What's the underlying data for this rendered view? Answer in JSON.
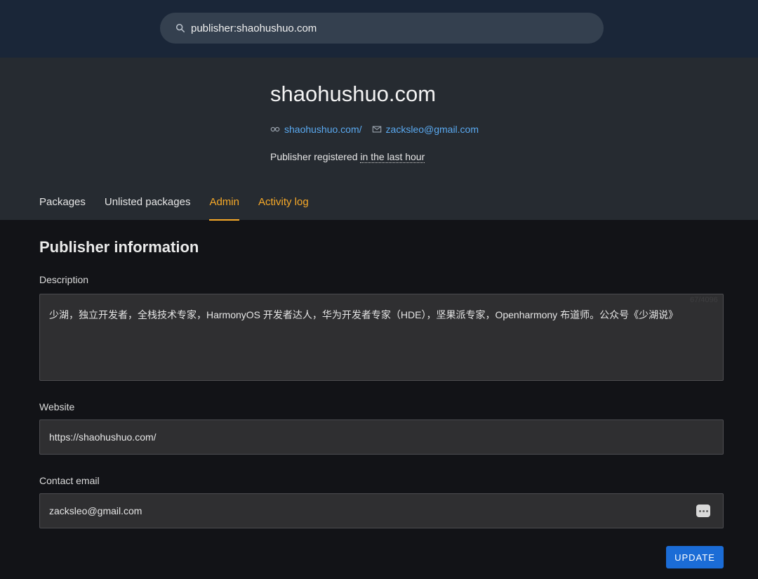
{
  "search": {
    "query": "publisher:shaohushuo.com",
    "icon": "search-icon"
  },
  "publisher": {
    "name": "shaohushuo.com",
    "website_link": "shaohushuo.com/",
    "email_link": "zacksleo@gmail.com",
    "registered_prefix": "Publisher registered ",
    "registered_time": "in the last hour"
  },
  "tabs": [
    {
      "label": "Packages"
    },
    {
      "label": "Unlisted packages"
    },
    {
      "label": "Admin"
    },
    {
      "label": "Activity log"
    }
  ],
  "form": {
    "section_title": "Publisher information",
    "description_label": "Description",
    "description_value": "少湖，独立开发者，全栈技术专家，HarmonyOS 开发者达人，华为开发者专家（HDE），坚果派专家，Openharmony 布道师。公众号《少湖说》",
    "description_counter": "67/4096",
    "website_label": "Website",
    "website_value": "https://shaohushuo.com/",
    "email_label": "Contact email",
    "email_value": "zacksleo@gmail.com",
    "update_label": "UPDATE"
  },
  "colors": {
    "accent": "#f7a928",
    "link": "#5aa9f0",
    "button": "#1b6cd6"
  }
}
